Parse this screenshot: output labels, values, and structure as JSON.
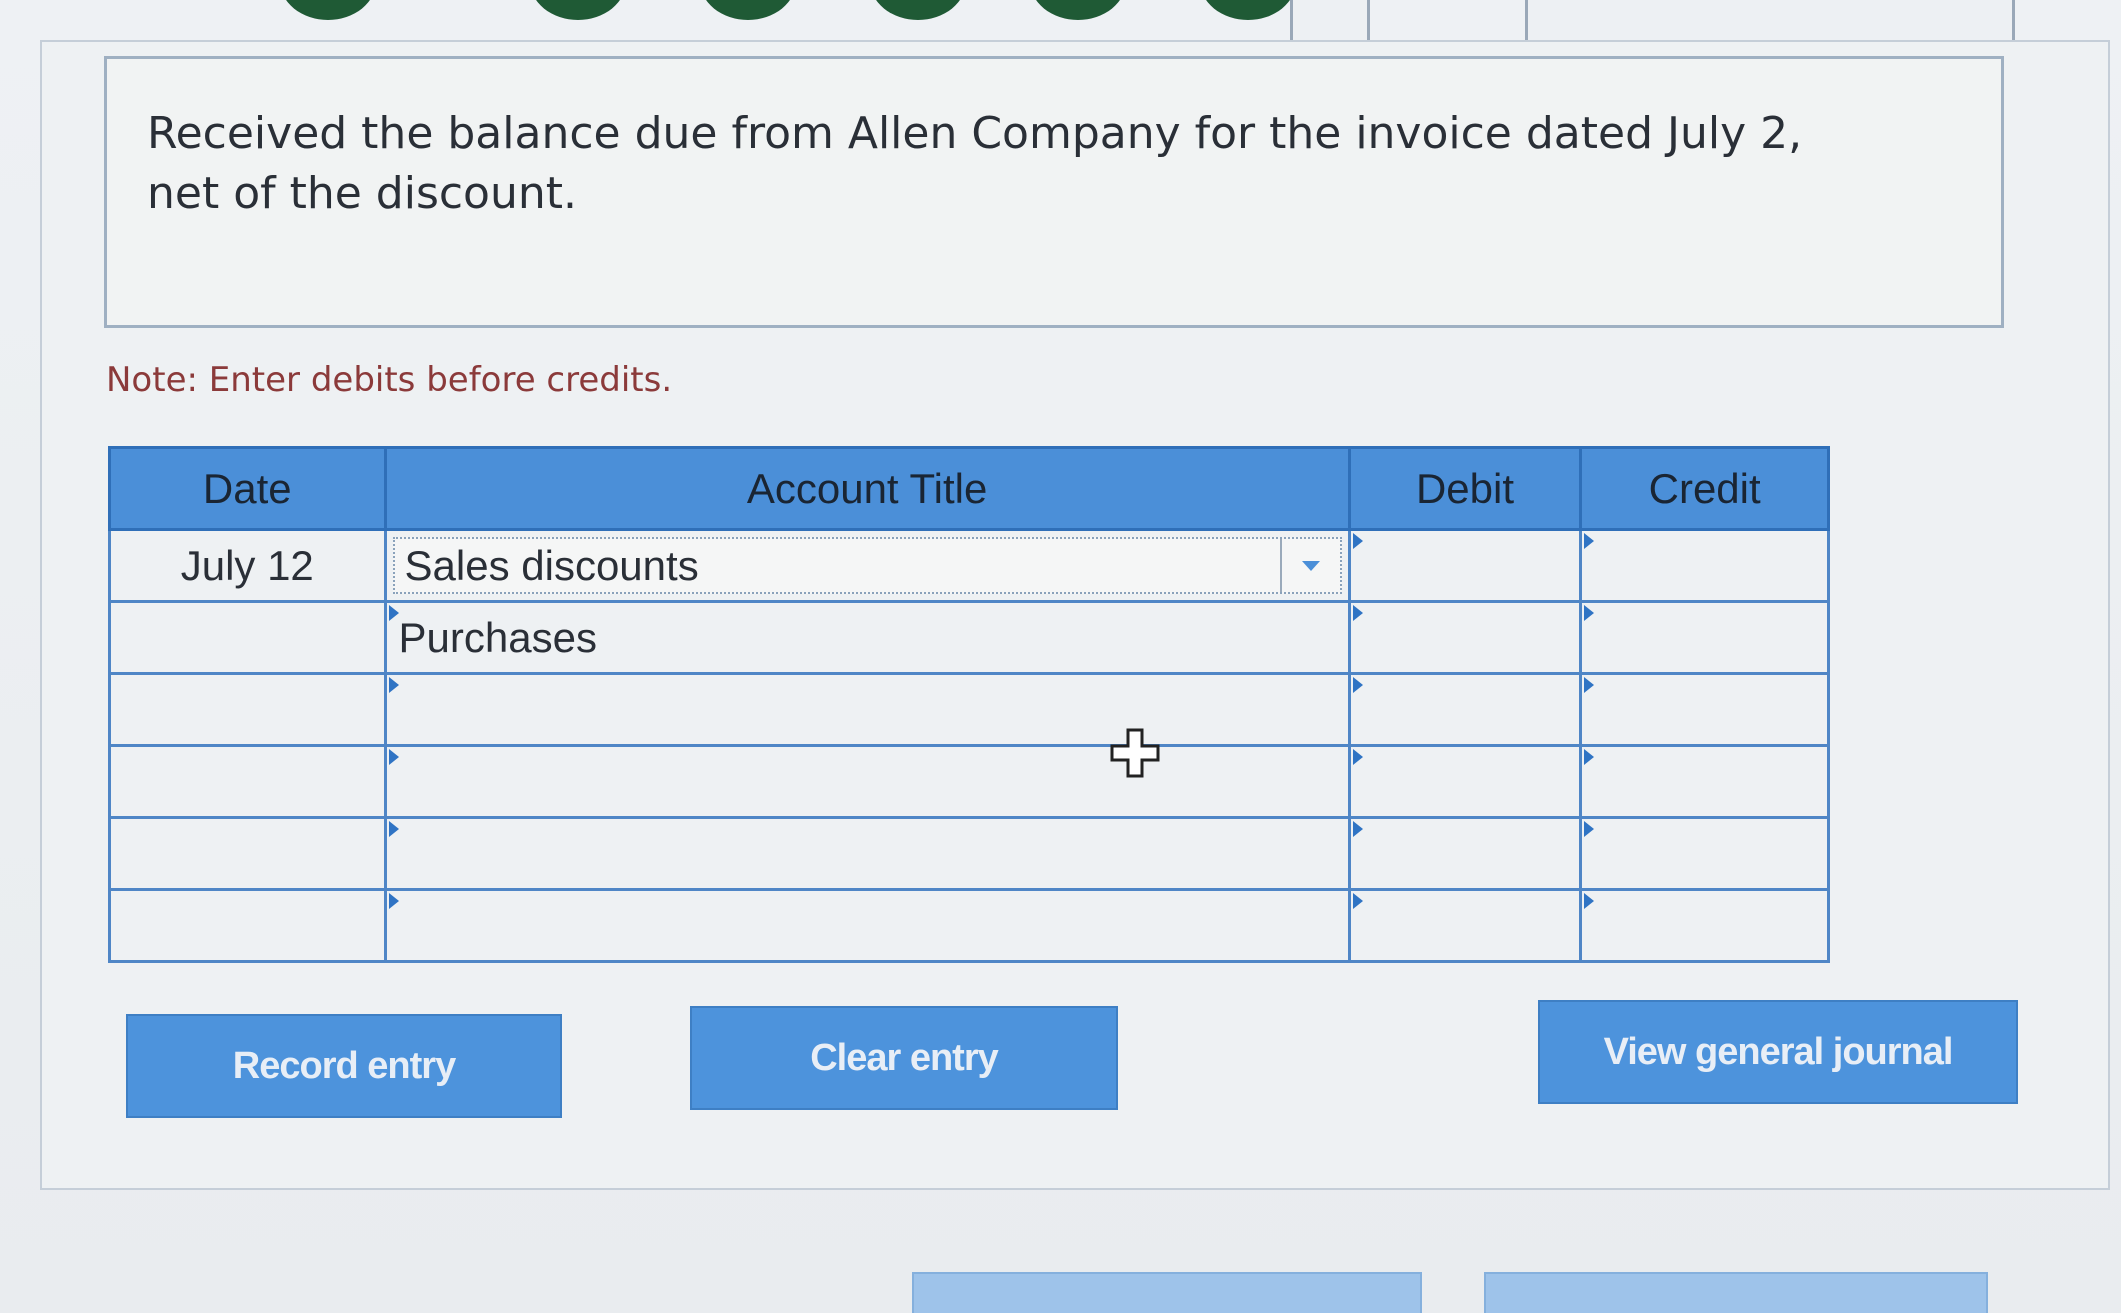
{
  "prompt": {
    "text": "Received the balance due from Allen Company for the invoice dated July 2, net of the discount."
  },
  "note": "Note: Enter debits before credits.",
  "journal": {
    "headers": {
      "date": "Date",
      "account_title": "Account Title",
      "debit": "Debit",
      "credit": "Credit"
    },
    "rows": [
      {
        "date": "July 12",
        "account": "Sales discounts",
        "debit": "",
        "credit": ""
      },
      {
        "date": "",
        "account": "Purchases",
        "debit": "",
        "credit": ""
      },
      {
        "date": "",
        "account": "",
        "debit": "",
        "credit": ""
      },
      {
        "date": "",
        "account": "",
        "debit": "",
        "credit": ""
      },
      {
        "date": "",
        "account": "",
        "debit": "",
        "credit": ""
      },
      {
        "date": "",
        "account": "",
        "debit": "",
        "credit": ""
      }
    ]
  },
  "buttons": {
    "record": "Record entry",
    "clear": "Clear entry",
    "view": "View general journal"
  },
  "colors": {
    "accent": "#4b8fd8",
    "note_text": "#8b3a3a",
    "dot_green": "#1f5a35"
  }
}
